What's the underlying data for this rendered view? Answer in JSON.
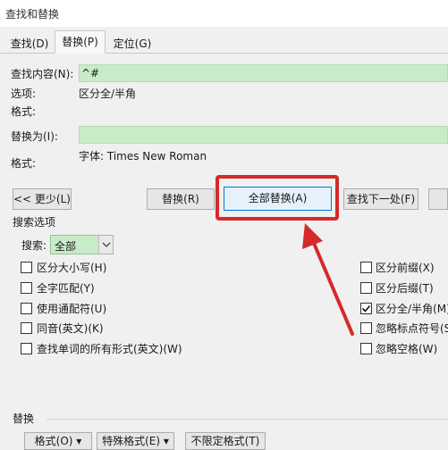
{
  "window": {
    "title": "查找和替换"
  },
  "tabs": [
    {
      "label": "查找(D)",
      "active": false
    },
    {
      "label": "替换(P)",
      "active": true
    },
    {
      "label": "定位(G)",
      "active": false
    }
  ],
  "find": {
    "label": "查找内容(N):",
    "value": "^#",
    "options_label": "选项:",
    "options_value": "区分全/半角",
    "format_label": "格式:"
  },
  "replace": {
    "label": "替换为(I):",
    "value": "",
    "format_label": "格式:",
    "format_value": "字体: Times New Roman"
  },
  "buttons": {
    "less": "<< 更少(L)",
    "replace": "替换(R)",
    "replace_all": "全部替换(A)",
    "find_next": "查找下一处(F)"
  },
  "search_options": {
    "header": "搜索选项",
    "search_label": "搜索:",
    "search_value": "全部",
    "left_checks": [
      {
        "label": "区分大小写(H)",
        "checked": false
      },
      {
        "label": "全字匹配(Y)",
        "checked": false
      },
      {
        "label": "使用通配符(U)",
        "checked": false
      },
      {
        "label": "同音(英文)(K)",
        "checked": false
      },
      {
        "label": "查找单词的所有形式(英文)(W)",
        "checked": false
      }
    ],
    "right_checks": [
      {
        "label": "区分前缀(X)",
        "checked": false
      },
      {
        "label": "区分后缀(T)",
        "checked": false
      },
      {
        "label": "区分全/半角(M)",
        "checked": true
      },
      {
        "label": "忽略标点符号(S)",
        "checked": false
      },
      {
        "label": "忽略空格(W)",
        "checked": false
      }
    ]
  },
  "replace_section": {
    "header": "替换",
    "format_btn": "格式(O) ▾",
    "special_btn": "特殊格式(E) ▾",
    "no_format_btn": "不限定格式(T)"
  },
  "colors": {
    "field_bg": "#c8ecc8",
    "annotation": "#d42a2a",
    "accent": "#0078d7"
  }
}
